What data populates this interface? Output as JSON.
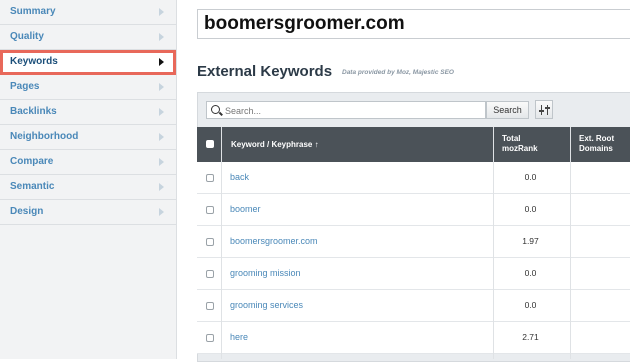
{
  "sidebar": {
    "items": [
      {
        "label": "Summary"
      },
      {
        "label": "Quality"
      },
      {
        "label": "Keywords"
      },
      {
        "label": "Pages"
      },
      {
        "label": "Backlinks"
      },
      {
        "label": "Neighborhood"
      },
      {
        "label": "Compare"
      },
      {
        "label": "Semantic"
      },
      {
        "label": "Design"
      }
    ],
    "active_index": 2
  },
  "domain": "boomersgroomer.com",
  "section": {
    "title": "External Keywords",
    "provided_by": "Data provided by Moz, Majestic SEO"
  },
  "search": {
    "placeholder": "Search...",
    "button_label": "Search"
  },
  "table": {
    "headers": {
      "keyword": "Keyword / Keyphrase ↑",
      "mozrank_line1": "Total",
      "mozrank_line2": "mozRank",
      "ext_line1": "Ext. Root",
      "ext_line2": "Domains"
    },
    "rows": [
      {
        "keyword": "back",
        "mozrank": "0.0"
      },
      {
        "keyword": "boomer",
        "mozrank": "0.0"
      },
      {
        "keyword": "boomersgroomer.com",
        "mozrank": "1.97"
      },
      {
        "keyword": "grooming mission",
        "mozrank": "0.0"
      },
      {
        "keyword": "grooming services",
        "mozrank": "0.0"
      },
      {
        "keyword": "here",
        "mozrank": "2.71"
      }
    ]
  },
  "colors": {
    "active_outline": "#e8685a",
    "link": "#4a88b8",
    "table_header": "#4b5258"
  }
}
